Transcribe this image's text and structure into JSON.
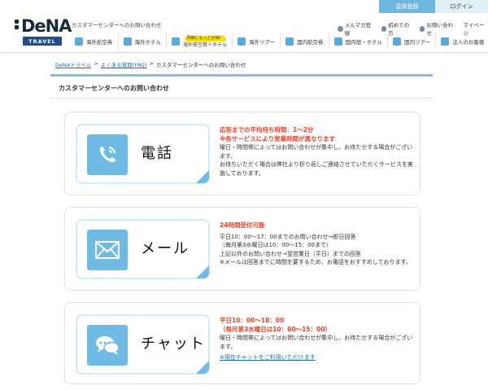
{
  "header": {
    "register_label": "会員登録",
    "login_label": "ログイン",
    "logo_text": "DeNA",
    "logo_badge": "TRAVEL",
    "site_title": "カスタマーセンターへのお問い合わせ",
    "util_links": [
      "メルマガ登録",
      "初めての方",
      "お問い合わせ",
      "マイページ"
    ],
    "nav": [
      {
        "label": "海外航空券",
        "icon": "plane-icon"
      },
      {
        "label": "海外ホテル",
        "icon": "hotel-icon"
      },
      {
        "promo": "同時にもっとお得！",
        "label": "海外航空券＋ホテル",
        "icon": "plane-hotel-icon"
      },
      {
        "label": "海外ツアー",
        "icon": "tour-icon"
      },
      {
        "label": "国内航空券",
        "icon": "plane-icon"
      },
      {
        "label": "国内宿・ホテル",
        "icon": "hotel-icon"
      },
      {
        "label": "国内ツアー",
        "icon": "tour-icon"
      },
      {
        "label": "法人のお客様",
        "icon": "briefcase-icon"
      }
    ]
  },
  "breadcrumb": {
    "items": [
      "DeNAトラベル",
      "よくある質問(FAQ)",
      "カスタマーセンターへのお問い合わせ"
    ],
    "separator": ">"
  },
  "page": {
    "title": "カスタマーセンターへのお問い合わせ"
  },
  "channels": {
    "phone": {
      "label": "電話",
      "icon": "phone-icon",
      "highlight1": "応答までの平均待ち時間：1～2分",
      "highlight2": "※各サービスにより営業時間が異なります",
      "line1": "曜日・時間帯によってはお問い合わせが集中し、お待たせする場合がございます。",
      "line2": "お待ちいただく場合は弊社より折り返しご連絡させていただくサービスを実施しております。"
    },
    "mail": {
      "label": "メール",
      "icon": "envelope-icon",
      "highlight1": "24時間受付可能",
      "line1": "平日10：00～17：00までのお問い合わせ→即日回答",
      "line2": "（毎月第3水曜日は10：00～15：00まで）",
      "line3": "上記以外のお問い合わせ→翌営業日（平日）までの回答",
      "line4": "※メールは回答までに時間を要するため、お電話をおすすめしております。"
    },
    "chat": {
      "label": "チャット",
      "icon": "chat-bubbles-icon",
      "highlight1": "平日10：00～18：00",
      "highlight2": "（毎月第3水曜日は10：00～15：00）",
      "line1": "曜日・時間帯によってはお問い合わせが集中し、お待たせする場合がございます。",
      "link": "※現在チャットをご利用いただけます"
    }
  },
  "colors": {
    "accent": "#6fbbe3",
    "highlight": "#e8412a",
    "link": "#1a6bb8"
  }
}
